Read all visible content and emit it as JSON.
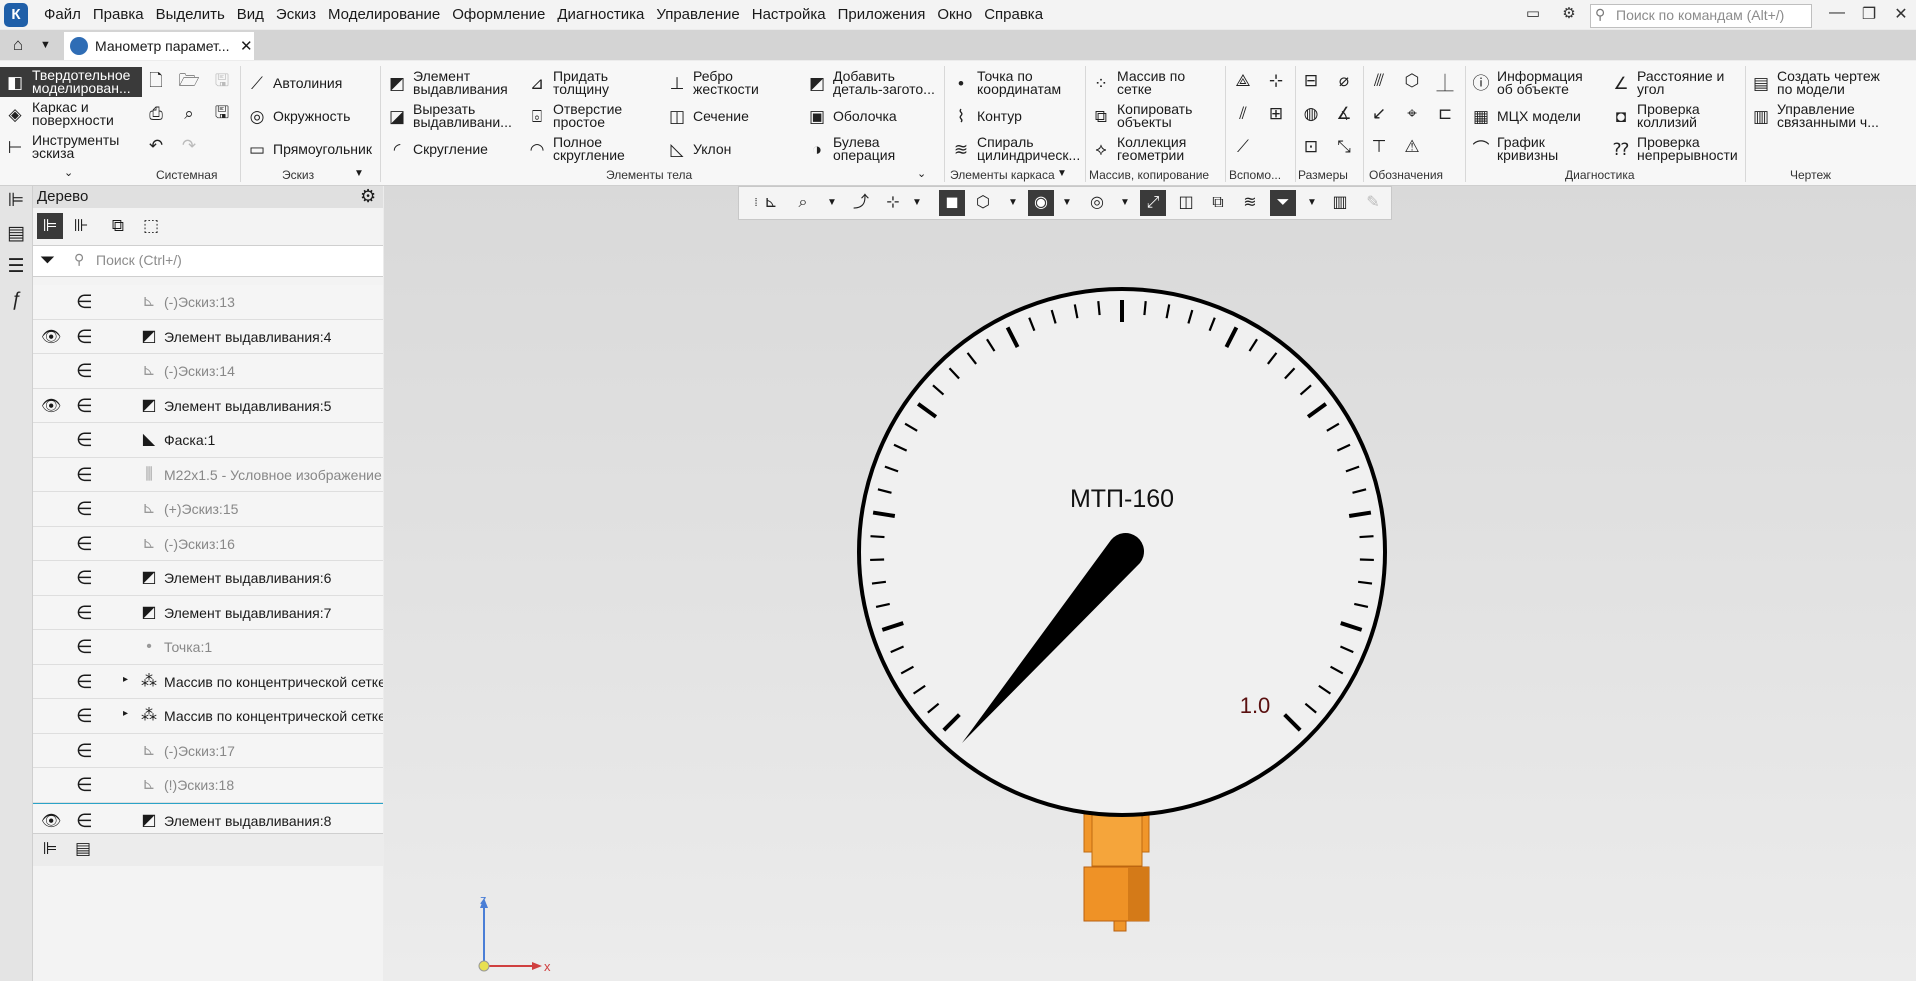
{
  "menubar": {
    "logo": "К",
    "items": [
      "Файл",
      "Правка",
      "Выделить",
      "Вид",
      "Эскиз",
      "Моделирование",
      "Оформление",
      "Диагностика",
      "Управление",
      "Настройка",
      "Приложения",
      "Окно",
      "Справка"
    ],
    "command_search_placeholder": "Поиск по командам (Alt+/)"
  },
  "tabs": {
    "document_tab": "Манометр парамет..."
  },
  "ribbon": {
    "modes": [
      "Твердотельное моделирован...",
      "Каркас и поверхности",
      "Инструменты эскиза"
    ],
    "groups": [
      "Системная",
      "Эскиз",
      "Элементы тела",
      "Элементы каркаса",
      "Массив, копирование",
      "Вспомо...",
      "Размеры",
      "Обозначения",
      "Диагностика",
      "Чертеж"
    ],
    "sketch": [
      "Автолиния",
      "Окружность",
      "Прямоугольник"
    ],
    "body": [
      "Элемент выдавливания",
      "Вырезать выдавливани...",
      "Скругление",
      "Придать толщину",
      "Отверстие простое",
      "Полное скругление",
      "Ребро жесткости",
      "Сечение",
      "Уклон",
      "Добавить деталь-загото...",
      "Оболочка",
      "Булева операция"
    ],
    "wireframe": [
      "Точка по координатам",
      "Контур",
      "Спираль цилиндрическ..."
    ],
    "array": [
      "Массив по сетке",
      "Копировать объекты",
      "Коллекция геометрии"
    ],
    "diagnostics": [
      "Информация об объекте",
      "МЦХ модели",
      "График кривизны",
      "Расстояние и угол",
      "Проверка коллизий",
      "Проверка непрерывности"
    ],
    "drawing": [
      "Создать чертеж по модели",
      "Управление связанными ч..."
    ]
  },
  "tree": {
    "title": "Дерево",
    "search_placeholder": "Поиск (Ctrl+/)",
    "rows": [
      {
        "label": "(-)Эскиз:13",
        "visible": false,
        "dim": true,
        "icon": "sketch-icon"
      },
      {
        "label": "Элемент выдавливания:4",
        "visible": true,
        "dim": false,
        "icon": "extrusion-icon"
      },
      {
        "label": "(-)Эскиз:14",
        "visible": false,
        "dim": true,
        "icon": "sketch-icon"
      },
      {
        "label": "Элемент выдавливания:5",
        "visible": true,
        "dim": false,
        "icon": "extrusion-icon"
      },
      {
        "label": "Фаска:1",
        "visible": false,
        "dim": false,
        "icon": "chamfer-icon"
      },
      {
        "label": "M22x1.5 - Условное изображение",
        "visible": false,
        "dim": true,
        "icon": "thread-icon"
      },
      {
        "label": "(+)Эскиз:15",
        "visible": false,
        "dim": true,
        "icon": "sketch-icon"
      },
      {
        "label": "(-)Эскиз:16",
        "visible": false,
        "dim": true,
        "icon": "sketch-icon"
      },
      {
        "label": "Элемент выдавливания:6",
        "visible": false,
        "dim": false,
        "icon": "extrusion-icon"
      },
      {
        "label": "Элемент выдавливания:7",
        "visible": false,
        "dim": false,
        "icon": "extrusion-icon"
      },
      {
        "label": "Точка:1",
        "visible": false,
        "dim": true,
        "icon": "point-icon"
      },
      {
        "label": "Массив по концентрической сетке",
        "visible": false,
        "dim": false,
        "icon": "array-icon",
        "expandable": true
      },
      {
        "label": "Массив по концентрической сетке",
        "visible": false,
        "dim": false,
        "icon": "array-icon",
        "expandable": true
      },
      {
        "label": "(-)Эскиз:17",
        "visible": false,
        "dim": true,
        "icon": "sketch-icon"
      },
      {
        "label": "(!)Эскиз:18",
        "visible": false,
        "dim": true,
        "icon": "sketch-icon"
      },
      {
        "label": "Элемент выдавливания:8",
        "visible": true,
        "dim": false,
        "icon": "extrusion-icon",
        "selected": true
      }
    ]
  },
  "viewport": {
    "gauge_model": "МТП-160",
    "scale_value": "1.0",
    "axis_z": "z",
    "axis_x": "x",
    "colors": {
      "fitting": "#f0962a",
      "needle": "#000000",
      "dial": "#f0f0f0",
      "scale_value": "#5a1010"
    }
  }
}
